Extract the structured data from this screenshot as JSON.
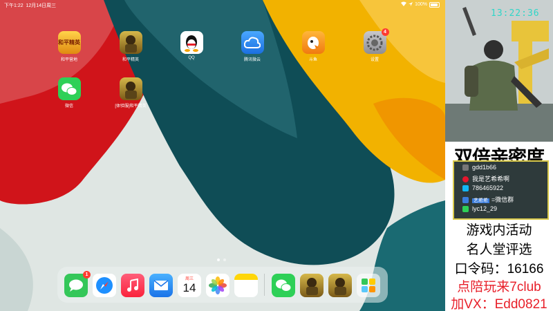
{
  "status": {
    "time": "下午1:22",
    "date": "12月14日周三",
    "battery": "100%"
  },
  "apps": [
    {
      "label": "和平营地",
      "icon_text": "和平精英",
      "color": "#f0b020",
      "badge": ""
    },
    {
      "label": "和平精英",
      "icon_text": "",
      "color": "#b9962a",
      "badge": ""
    },
    {
      "label": "QQ",
      "icon_text": "",
      "color": "#ffffff",
      "badge": ""
    },
    {
      "label": "腾讯微云",
      "icon_text": "",
      "color": "#2e8df0",
      "badge": ""
    },
    {
      "label": "斗鱼",
      "icon_text": "",
      "color": "#f29a1c",
      "badge": ""
    },
    {
      "label": "设置",
      "icon_text": "",
      "color": "#8e8e93",
      "badge": "4"
    },
    {
      "label": "微信",
      "icon_text": "",
      "color": "#2ed057",
      "badge": ""
    },
    {
      "label": "[体验服]和平精英",
      "icon_text": "",
      "color": "#b9962a",
      "badge": ""
    }
  ],
  "dock": {
    "messages_badge": "1",
    "calendar_day": "周三",
    "calendar_date": "14",
    "icons": [
      "messages-icon",
      "safari-icon",
      "music-icon",
      "mail-icon",
      "calendar-icon",
      "photos-icon",
      "notes-icon",
      "wechat-icon",
      "game-icon",
      "game-icon-2",
      "app-library-icon"
    ]
  },
  "stream": {
    "clock": "13:22:36",
    "title": "双倍亲密度",
    "card_rows": [
      {
        "icon": "user-icon",
        "text": "gdd1b66"
      },
      {
        "icon": "weibo-icon",
        "text": "我是艺希希啊"
      },
      {
        "icon": "qq-icon",
        "text": "786465922"
      },
      {
        "icon": "group-icon",
        "text": "=微信群"
      },
      {
        "icon": "wechat-icon",
        "text": "lyc12_29"
      }
    ],
    "card_tags": [
      "艺希希"
    ],
    "lines": [
      "游戏内活动",
      "名人堂评选",
      "口令码：16166",
      "点陪玩来7club",
      "加VX：Edd0821"
    ]
  }
}
